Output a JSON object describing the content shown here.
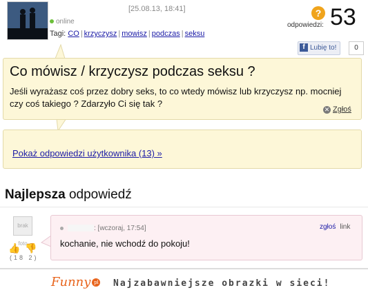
{
  "header": {
    "date": "[25.08.13, 18:41]",
    "status": "online",
    "tags_label": "Tagi:",
    "tags": [
      "CO",
      "krzyczysz",
      "mowisz",
      "podczas",
      "seksu"
    ],
    "answers_label": "odpowiedzi:",
    "answers_count": "53",
    "question_icon": "question-mark-icon",
    "like_label": "Lubię to!",
    "like_count": "0"
  },
  "question": {
    "title": "Co mówisz / krzyczysz podczas seksu ?",
    "body": "Jeśli wyrażasz coś przez dobry seks, to co wtedy mówisz lub krzyczysz np. mocniej czy coś takiego ? Zdarzyło Ci się tak ?",
    "report_label": "Zgłoś"
  },
  "user_answers_link": "Pokaż odpowiedzi użytkownika (13) »",
  "best_answer": {
    "heading_bold": "Najlepsza",
    "heading_rest": "odpowiedź",
    "meta": ": [wczoraj, 17:54]",
    "report_label": "zgłoś",
    "link_label": "link",
    "text": "kochanie, nie wchodź do pokoju!",
    "votes_up": "18",
    "votes_down": "2",
    "avatar_text": "brak foto"
  },
  "footer": {
    "logo": "Funny",
    "logo_badge": "pl",
    "slogan": "Najzabawniejsze obrazki w sieci!"
  },
  "colors": {
    "yellow_box": "#fdf7d8",
    "pink_box": "#fdf0f3",
    "link": "#1a1aa6",
    "accent_orange": "#e8641c"
  }
}
